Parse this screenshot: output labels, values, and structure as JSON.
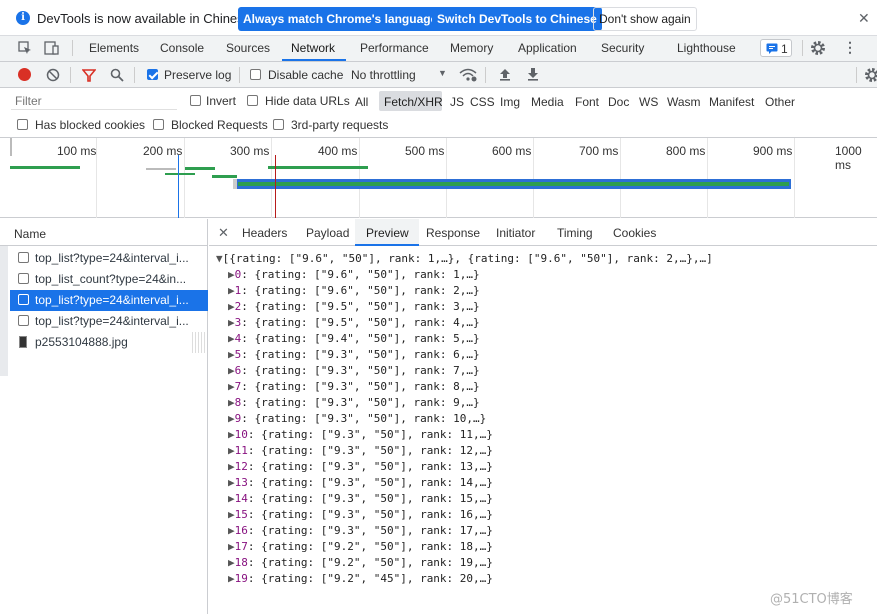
{
  "infobar": {
    "text": "DevTools is now available in Chinese!",
    "btn_match": "Always match Chrome's language",
    "btn_switch": "Switch DevTools to Chinese",
    "btn_dismiss": "Don't show again"
  },
  "tabs": [
    "Elements",
    "Console",
    "Sources",
    "Network",
    "Performance",
    "Memory",
    "Application",
    "Security",
    "Lighthouse"
  ],
  "issues_count": "1",
  "toolbar": {
    "preserve_log": "Preserve log",
    "disable_cache": "Disable cache",
    "throttling": "No throttling"
  },
  "filter": {
    "placeholder": "Filter",
    "invert": "Invert",
    "hide_data_urls": "Hide data URLs",
    "types": [
      "All",
      "Fetch/XHR",
      "JS",
      "CSS",
      "Img",
      "Media",
      "Font",
      "Doc",
      "WS",
      "Wasm",
      "Manifest",
      "Other"
    ],
    "has_blocked_cookies": "Has blocked cookies",
    "blocked_requests": "Blocked Requests",
    "third_party": "3rd-party requests"
  },
  "timeline_ticks": [
    "100 ms",
    "200 ms",
    "300 ms",
    "400 ms",
    "500 ms",
    "600 ms",
    "700 ms",
    "800 ms",
    "900 ms",
    "1000 ms"
  ],
  "name_header": "Name",
  "requests": [
    "top_list?type=24&interval_i...",
    "top_list_count?type=24&in...",
    "top_list?type=24&interval_i...",
    "top_list?type=24&interval_i...",
    "p2553104888.jpg"
  ],
  "detail_tabs": [
    "Headers",
    "Payload",
    "Preview",
    "Response",
    "Initiator",
    "Timing",
    "Cookies"
  ],
  "preview_summary": "[{rating: [\"9.6\", \"50\"], rank: 1,…}, {rating: [\"9.6\", \"50\"], rank: 2,…},…]",
  "preview_items": [
    {
      "idx": "0",
      "text": "{rating: [\"9.6\", \"50\"], rank: 1,…}"
    },
    {
      "idx": "1",
      "text": "{rating: [\"9.6\", \"50\"], rank: 2,…}"
    },
    {
      "idx": "2",
      "text": "{rating: [\"9.5\", \"50\"], rank: 3,…}"
    },
    {
      "idx": "3",
      "text": "{rating: [\"9.5\", \"50\"], rank: 4,…}"
    },
    {
      "idx": "4",
      "text": "{rating: [\"9.4\", \"50\"], rank: 5,…}"
    },
    {
      "idx": "5",
      "text": "{rating: [\"9.3\", \"50\"], rank: 6,…}"
    },
    {
      "idx": "6",
      "text": "{rating: [\"9.3\", \"50\"], rank: 7,…}"
    },
    {
      "idx": "7",
      "text": "{rating: [\"9.3\", \"50\"], rank: 8,…}"
    },
    {
      "idx": "8",
      "text": "{rating: [\"9.3\", \"50\"], rank: 9,…}"
    },
    {
      "idx": "9",
      "text": "{rating: [\"9.3\", \"50\"], rank: 10,…}"
    },
    {
      "idx": "10",
      "text": "{rating: [\"9.3\", \"50\"], rank: 11,…}"
    },
    {
      "idx": "11",
      "text": "{rating: [\"9.3\", \"50\"], rank: 12,…}"
    },
    {
      "idx": "12",
      "text": "{rating: [\"9.3\", \"50\"], rank: 13,…}"
    },
    {
      "idx": "13",
      "text": "{rating: [\"9.3\", \"50\"], rank: 14,…}"
    },
    {
      "idx": "14",
      "text": "{rating: [\"9.3\", \"50\"], rank: 15,…}"
    },
    {
      "idx": "15",
      "text": "{rating: [\"9.3\", \"50\"], rank: 16,…}"
    },
    {
      "idx": "16",
      "text": "{rating: [\"9.3\", \"50\"], rank: 17,…}"
    },
    {
      "idx": "17",
      "text": "{rating: [\"9.2\", \"50\"], rank: 18,…}"
    },
    {
      "idx": "18",
      "text": "{rating: [\"9.2\", \"50\"], rank: 19,…}"
    },
    {
      "idx": "19",
      "text": "{rating: [\"9.2\", \"45\"], rank: 20,…}"
    }
  ],
  "watermark": "@51CTO博客",
  "colors": {
    "accent": "#1a73e8",
    "selected_row": "#1a73e8",
    "record": "#d93025",
    "filter_red": "#d93025"
  }
}
